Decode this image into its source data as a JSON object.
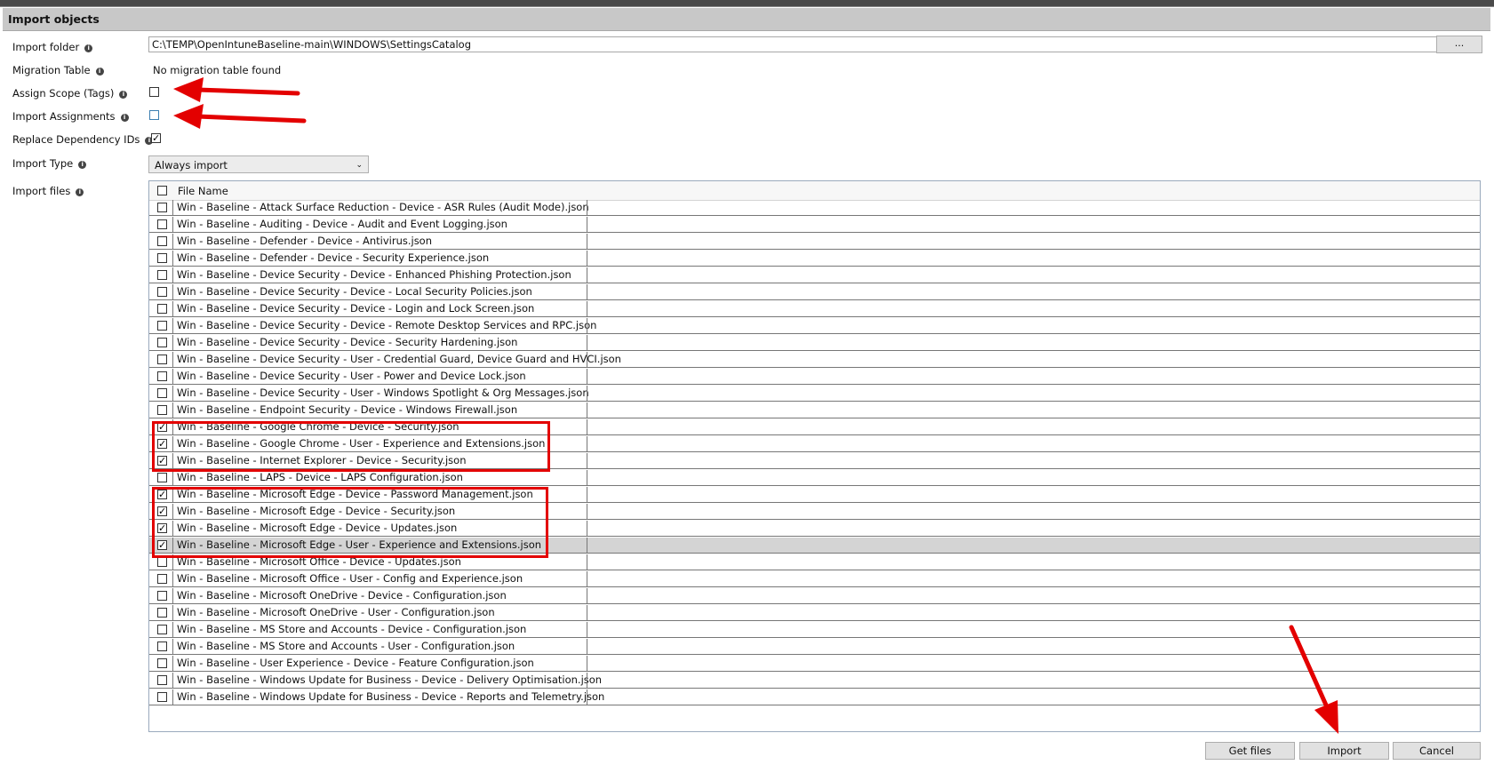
{
  "dialog": {
    "title": "Import objects"
  },
  "fields": {
    "import_folder": {
      "label": "Import folder",
      "value": "C:\\TEMP\\OpenIntuneBaseline-main\\WINDOWS\\SettingsCatalog",
      "browse_label": "..."
    },
    "migration_table": {
      "label": "Migration Table",
      "value": "No migration table found"
    },
    "assign_scope": {
      "label": "Assign Scope (Tags)",
      "checked": false
    },
    "import_assignments": {
      "label": "Import Assignments",
      "checked": false
    },
    "replace_dependency": {
      "label": "Replace Dependency IDs",
      "checked": true
    },
    "import_type": {
      "label": "Import Type",
      "value": "Always import"
    },
    "import_files": {
      "label": "Import files"
    }
  },
  "grid": {
    "column_header": "File Name",
    "rows": [
      {
        "name": "Win - Baseline - Attack Surface Reduction - Device - ASR Rules (Audit Mode).json",
        "checked": false
      },
      {
        "name": "Win - Baseline - Auditing - Device - Audit and Event Logging.json",
        "checked": false
      },
      {
        "name": "Win - Baseline - Defender - Device - Antivirus.json",
        "checked": false
      },
      {
        "name": "Win - Baseline - Defender - Device - Security Experience.json",
        "checked": false
      },
      {
        "name": "Win - Baseline - Device Security - Device - Enhanced Phishing Protection.json",
        "checked": false
      },
      {
        "name": "Win - Baseline - Device Security - Device - Local Security Policies.json",
        "checked": false
      },
      {
        "name": "Win - Baseline - Device Security - Device - Login and Lock Screen.json",
        "checked": false
      },
      {
        "name": "Win - Baseline - Device Security - Device - Remote Desktop Services and RPC.json",
        "checked": false
      },
      {
        "name": "Win - Baseline - Device Security - Device - Security Hardening.json",
        "checked": false
      },
      {
        "name": "Win - Baseline - Device Security - User - Credential Guard, Device Guard and HVCI.json",
        "checked": false
      },
      {
        "name": "Win - Baseline - Device Security - User - Power and Device Lock.json",
        "checked": false
      },
      {
        "name": "Win - Baseline - Device Security - User - Windows Spotlight & Org Messages.json",
        "checked": false
      },
      {
        "name": "Win - Baseline - Endpoint Security - Device - Windows Firewall.json",
        "checked": false
      },
      {
        "name": "Win - Baseline - Google Chrome - Device - Security.json",
        "checked": true
      },
      {
        "name": "Win - Baseline - Google Chrome - User - Experience and Extensions.json",
        "checked": true
      },
      {
        "name": "Win - Baseline - Internet Explorer - Device - Security.json",
        "checked": true
      },
      {
        "name": "Win - Baseline - LAPS - Device - LAPS Configuration.json",
        "checked": false
      },
      {
        "name": "Win - Baseline - Microsoft Edge - Device - Password Management.json",
        "checked": true
      },
      {
        "name": "Win - Baseline - Microsoft Edge - Device - Security.json",
        "checked": true
      },
      {
        "name": "Win - Baseline - Microsoft Edge - Device - Updates.json",
        "checked": true
      },
      {
        "name": "Win - Baseline - Microsoft Edge - User - Experience and Extensions.json",
        "checked": true,
        "selected": true
      },
      {
        "name": "Win - Baseline - Microsoft Office - Device - Updates.json",
        "checked": false
      },
      {
        "name": "Win - Baseline - Microsoft Office - User - Config and Experience.json",
        "checked": false
      },
      {
        "name": "Win - Baseline - Microsoft OneDrive - Device - Configuration.json",
        "checked": false
      },
      {
        "name": "Win - Baseline - Microsoft OneDrive - User - Configuration.json",
        "checked": false
      },
      {
        "name": "Win - Baseline - MS Store and Accounts - Device - Configuration.json",
        "checked": false
      },
      {
        "name": "Win - Baseline - MS Store and Accounts - User - Configuration.json",
        "checked": false
      },
      {
        "name": "Win - Baseline - User Experience - Device - Feature Configuration.json",
        "checked": false
      },
      {
        "name": "Win - Baseline - Windows Update for Business - Device - Delivery Optimisation.json",
        "checked": false
      },
      {
        "name": "Win - Baseline - Windows Update for Business - Device - Reports and Telemetry.json",
        "checked": false
      }
    ]
  },
  "buttons": {
    "get_files": "Get files",
    "import": "Import",
    "cancel": "Cancel"
  },
  "colors": {
    "annotation": "#e30000",
    "selected_row": "#d4d4d4",
    "title_bar": "#c8c8c8"
  },
  "icons": {
    "info": "info-icon",
    "check": "checkmark-icon",
    "dropdown": "chevron-down-icon"
  }
}
